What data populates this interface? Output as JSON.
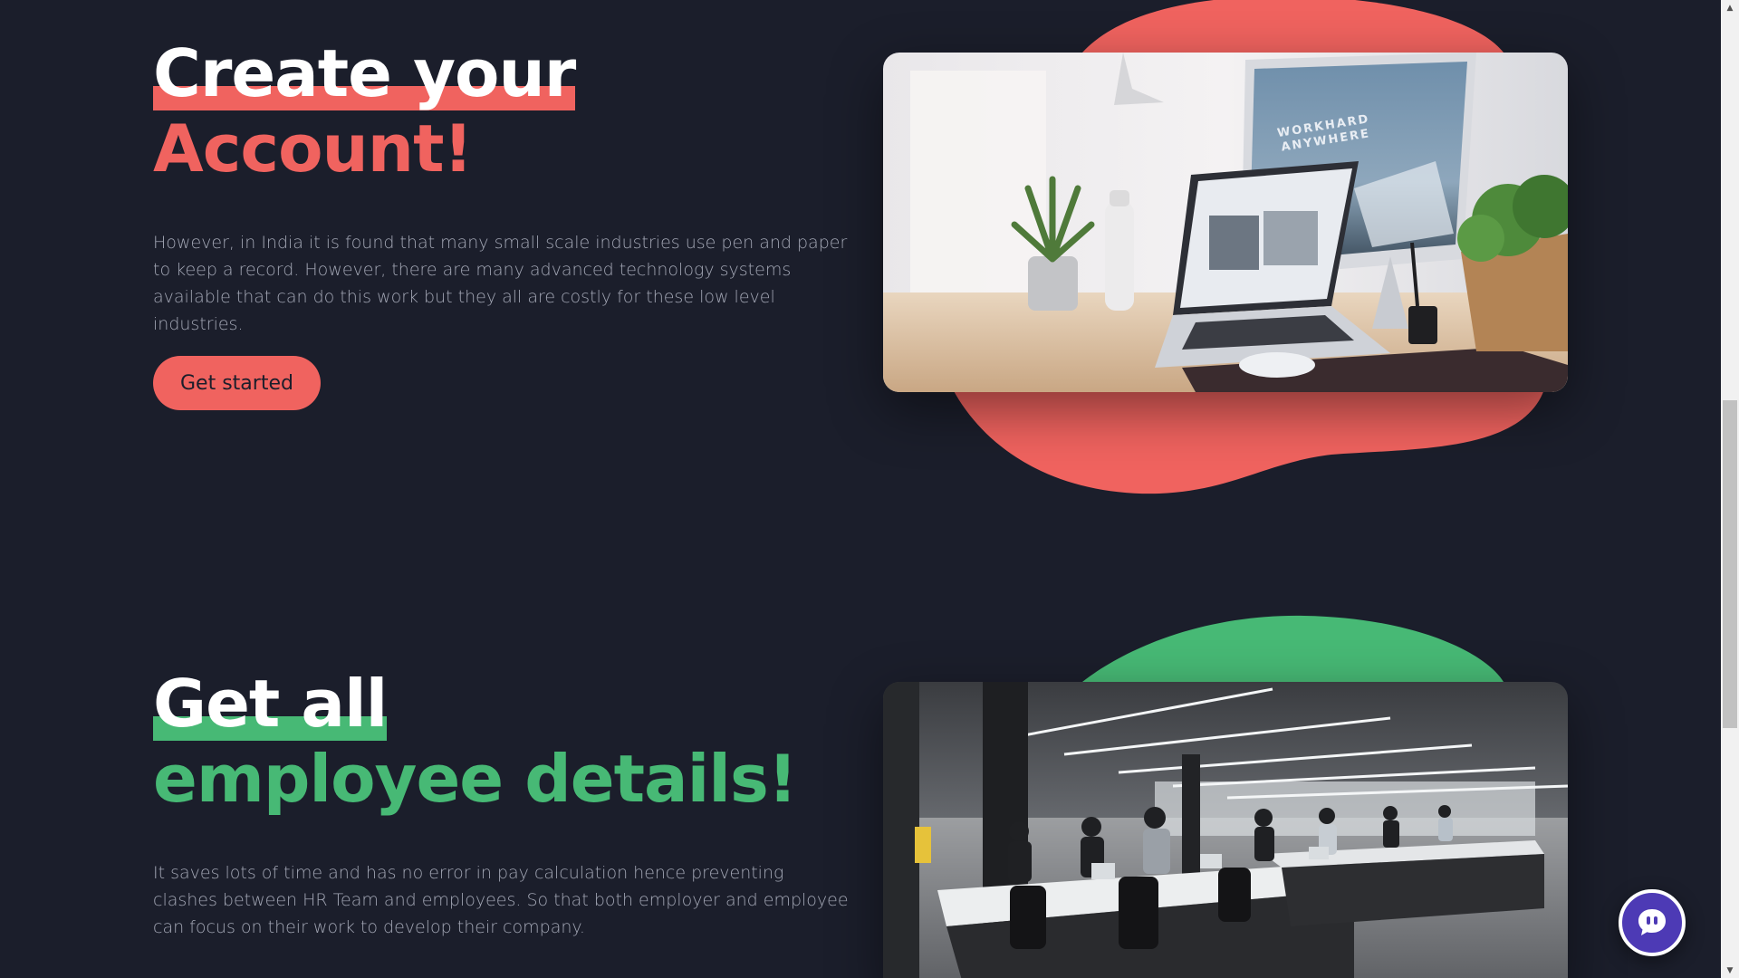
{
  "colors": {
    "background": "#1b1e2b",
    "accent_red": "#f0635f",
    "accent_green": "#47b975",
    "text_muted": "#a3a7b5",
    "chat_button": "#4d3ab5"
  },
  "section_account": {
    "title_line1": "Create your",
    "title_line2": "Account!",
    "description": "However, in India it is found that many small scale industries use pen and paper to keep a record. However, there are many advanced technology systems available that can do this work but they all are costly for these low level industries.",
    "button_label": "Get started",
    "image_caption_line1": "WORKHARD",
    "image_caption_line2": "ANYWHERE"
  },
  "section_employees": {
    "title_line1": "Get all",
    "title_line2": "employee details!",
    "description": "It saves lots of time and has no error in pay calculation hence preventing clashes between HR Team and employees. So that both employer and employee can focus on their work to develop their company."
  },
  "icons": {
    "chat": "chat-bubble-icon",
    "scroll_up": "triangle-up-icon",
    "scroll_down": "triangle-down-icon"
  }
}
